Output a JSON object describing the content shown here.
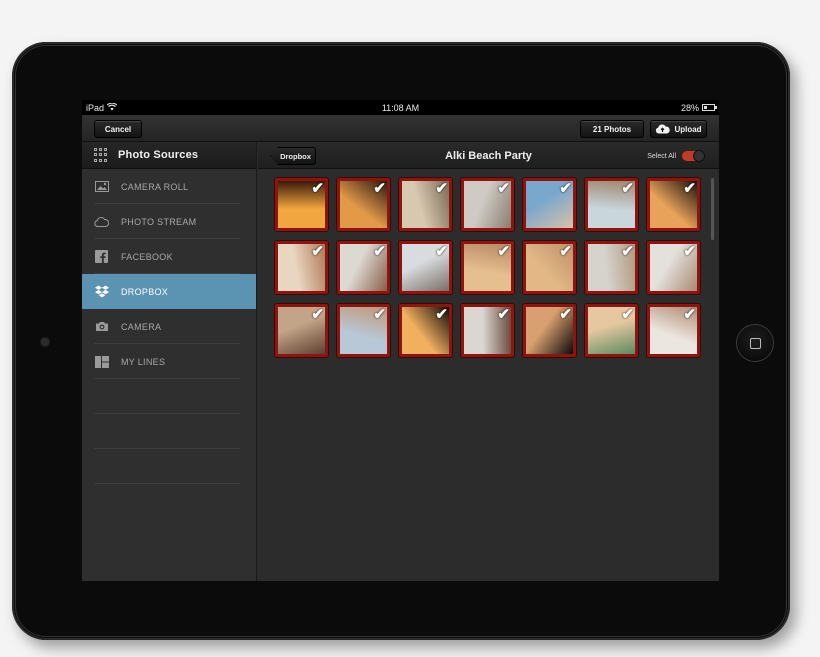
{
  "status": {
    "carrier": "iPad",
    "time": "11:08 AM",
    "battery": "28%",
    "battery_level": 0.28
  },
  "toolbar": {
    "cancel_label": "Cancel",
    "photos_label": "21 Photos",
    "upload_label": "Upload"
  },
  "sidebar": {
    "title": "Photo Sources",
    "items": [
      {
        "label": "CAMERA ROLL",
        "icon": "image-icon"
      },
      {
        "label": "PHOTO STREAM",
        "icon": "cloud-icon"
      },
      {
        "label": "FACEBOOK",
        "icon": "facebook-icon"
      },
      {
        "label": "DROPBOX",
        "icon": "dropbox-icon",
        "active": true
      },
      {
        "label": "CAMERA",
        "icon": "camera-icon"
      },
      {
        "label": "MY LINES",
        "icon": "layout-icon"
      }
    ]
  },
  "album": {
    "back_label": "Dropbox",
    "title": "Alki Beach Party",
    "select_all_label": "Select All",
    "select_all_on": true,
    "selection_color": "#8e1410",
    "photos": [
      {
        "selected": true,
        "tone": [
          "#f2a640",
          "#3a1a0a"
        ]
      },
      {
        "selected": true,
        "tone": [
          "#e29a48",
          "#2d1a12"
        ]
      },
      {
        "selected": true,
        "tone": [
          "#d9c8b0",
          "#7a6a55"
        ]
      },
      {
        "selected": true,
        "tone": [
          "#cfcbc4",
          "#8a7e70"
        ]
      },
      {
        "selected": true,
        "tone": [
          "#7aa8cc",
          "#d8c2a8"
        ]
      },
      {
        "selected": true,
        "tone": [
          "#c9d6dc",
          "#a08870"
        ]
      },
      {
        "selected": true,
        "tone": [
          "#e8a25a",
          "#1a120c"
        ]
      },
      {
        "selected": true,
        "tone": [
          "#e9d6c0",
          "#b07a58"
        ]
      },
      {
        "selected": true,
        "tone": [
          "#dcd8d2",
          "#8a5f48"
        ]
      },
      {
        "selected": true,
        "tone": [
          "#d8dcdf",
          "#7a6e66"
        ]
      },
      {
        "selected": true,
        "tone": [
          "#e6bf90",
          "#b88a64"
        ]
      },
      {
        "selected": true,
        "tone": [
          "#e2b886",
          "#c09068"
        ]
      },
      {
        "selected": true,
        "tone": [
          "#d6d2cc",
          "#b29a80"
        ]
      },
      {
        "selected": true,
        "tone": [
          "#e4e0dc",
          "#a98a74"
        ]
      },
      {
        "selected": true,
        "tone": [
          "#c2a488",
          "#5e4030"
        ]
      },
      {
        "selected": true,
        "tone": [
          "#b8c8d6",
          "#c29878"
        ]
      },
      {
        "selected": true,
        "tone": [
          "#f0b060",
          "#120c08"
        ]
      },
      {
        "selected": true,
        "tone": [
          "#dad6d2",
          "#6a4a3a"
        ]
      },
      {
        "selected": true,
        "tone": [
          "#d8a070",
          "#0e0a08"
        ]
      },
      {
        "selected": true,
        "tone": [
          "#e6c8a0",
          "#5c8a60"
        ]
      },
      {
        "selected": true,
        "tone": [
          "#ece6e0",
          "#b08c74"
        ]
      }
    ]
  }
}
